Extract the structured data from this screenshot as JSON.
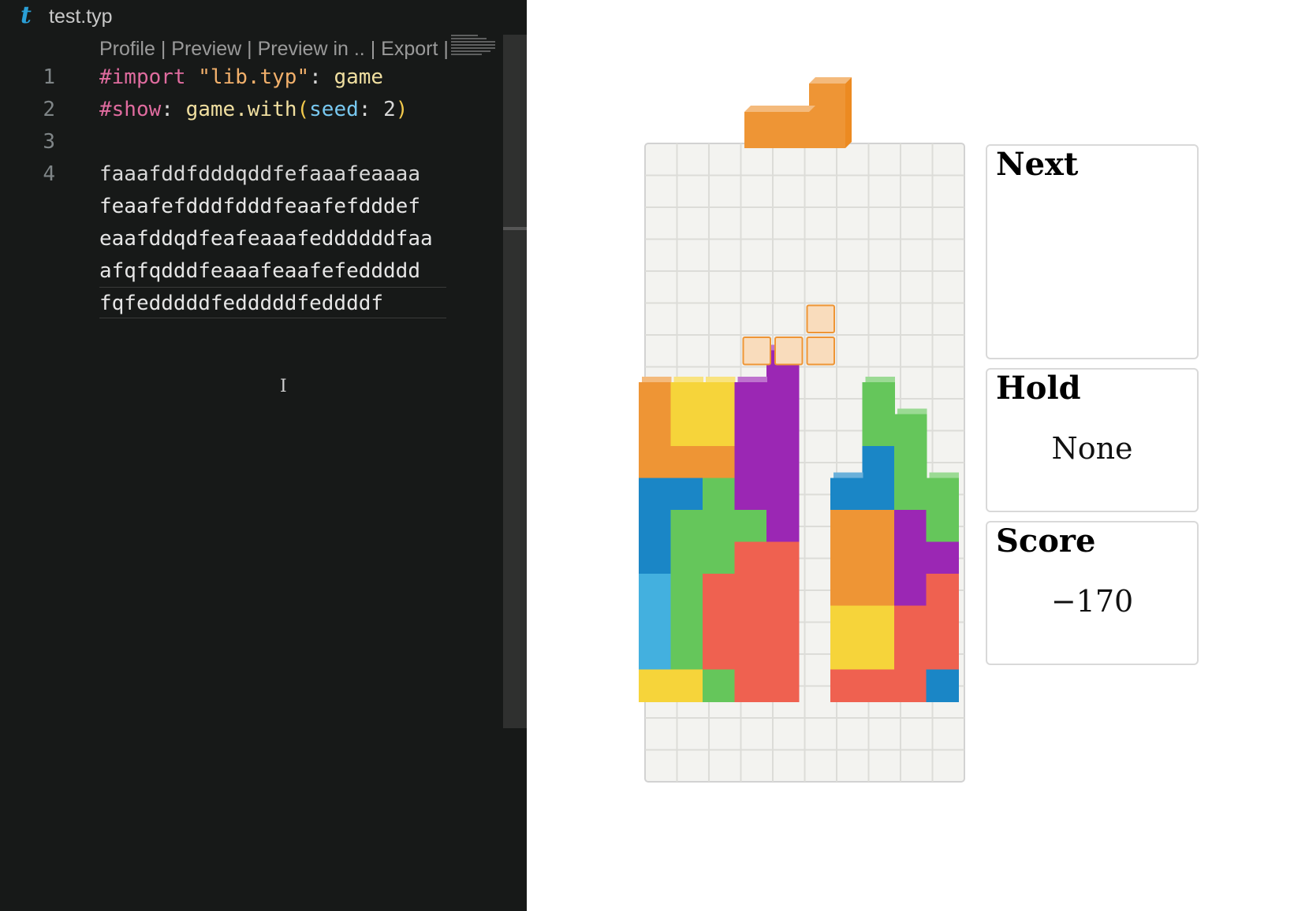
{
  "editor": {
    "tab": {
      "logo": "t",
      "filename": "test.typ"
    },
    "codelens": [
      "Profile",
      "Preview",
      "Preview in ..",
      "Export"
    ],
    "lines": [
      {
        "number": "1",
        "tokens": [
          {
            "t": "#import",
            "c": "kw"
          },
          {
            "t": " ",
            "c": "punct"
          },
          {
            "t": "\"lib.typ\"",
            "c": "str"
          },
          {
            "t": ": ",
            "c": "punct"
          },
          {
            "t": "game",
            "c": "fn"
          }
        ]
      },
      {
        "number": "2",
        "tokens": [
          {
            "t": "#show",
            "c": "kw"
          },
          {
            "t": ": ",
            "c": "punct"
          },
          {
            "t": "game.with",
            "c": "fn"
          },
          {
            "t": "(",
            "c": "paren"
          },
          {
            "t": "seed",
            "c": "param"
          },
          {
            "t": ": 2",
            "c": "punct"
          },
          {
            "t": ")",
            "c": "paren"
          }
        ]
      },
      {
        "number": "3",
        "tokens": []
      },
      {
        "number": "4",
        "tokens": [
          {
            "t": "faaafddfdddqddfefaaafeaaaa",
            "c": "punct"
          }
        ]
      }
    ],
    "wrapped_continuation": [
      "feaafefdddfdddfeaafefdddef",
      "eaafddqdfeafeaaafeddddddfaa",
      "afqfqdddfeaaafeaafefeddddd",
      "fqfedddddfedddddfeddddf"
    ]
  },
  "game": {
    "colors": {
      "O": "#f6d43a",
      "L": "#ee9535",
      "T": "#9b27b4",
      "S": "#65c65b",
      "J": "#1a86c6",
      "I": "#43b0df",
      "Z": "#ef6150"
    },
    "falling_piece": {
      "type": "L"
    },
    "ghost_piece": {
      "type": "L"
    },
    "next": {
      "title": "Next",
      "piece": "L"
    },
    "hold": {
      "title": "Hold",
      "value": "None"
    },
    "score": {
      "title": "Score",
      "value": "−170"
    }
  }
}
